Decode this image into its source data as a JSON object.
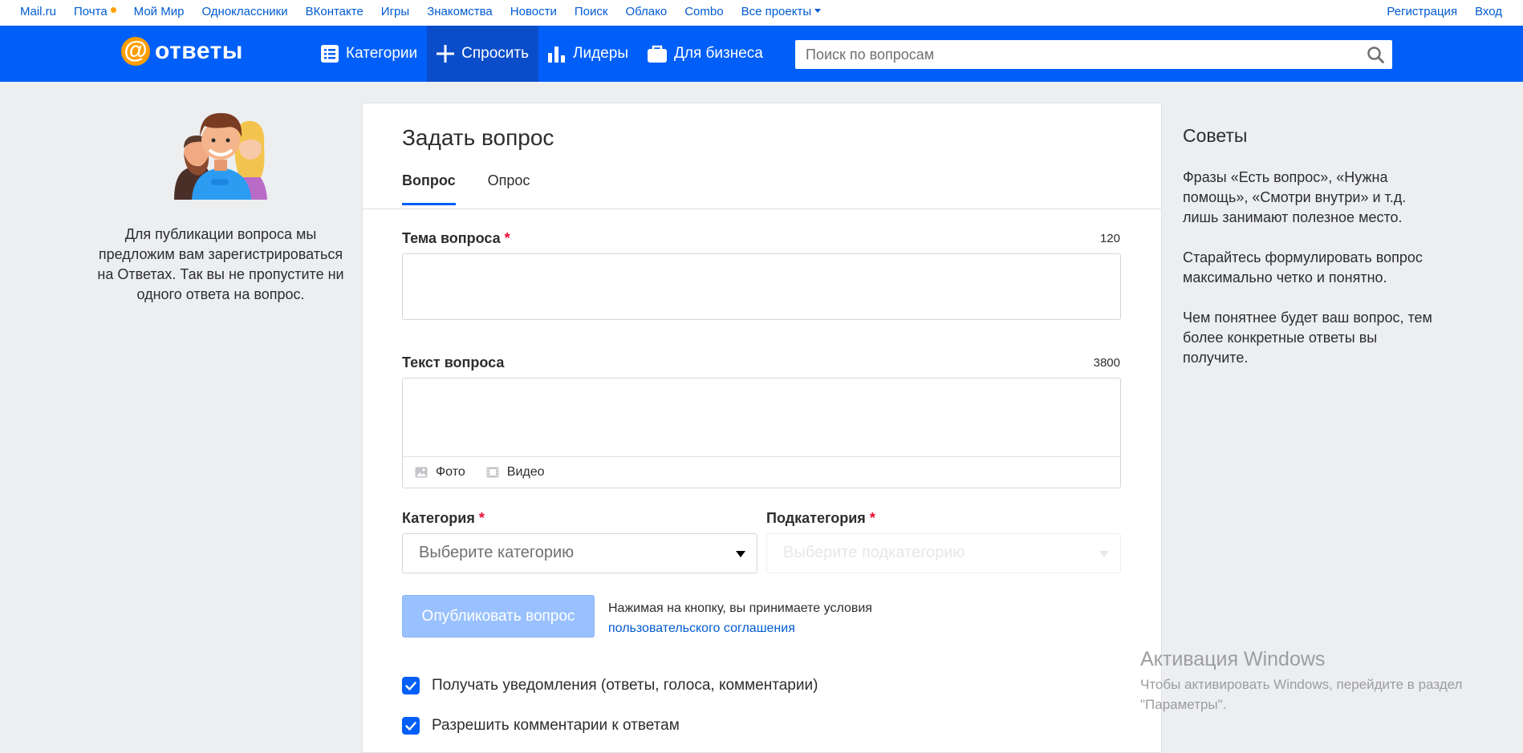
{
  "portal": {
    "links": [
      "Mail.ru",
      "Почта",
      "Мой Мир",
      "Одноклассники",
      "ВКонтакте",
      "Игры",
      "Знакомства",
      "Новости",
      "Поиск",
      "Облако",
      "Combo",
      "Все проекты"
    ],
    "register": "Регистрация",
    "login": "Вход"
  },
  "header": {
    "logo_at": "@",
    "logo_text": "ответы",
    "nav": [
      "Категории",
      "Спросить",
      "Лидеры",
      "Для бизнеса"
    ],
    "search_placeholder": "Поиск по вопросам"
  },
  "left": {
    "text": "Для публикации вопроса мы предложим вам зарегистрироваться на Ответах. Так вы не пропустите ни одного ответа на вопрос."
  },
  "form": {
    "title": "Задать вопрос",
    "tabs": [
      "Вопрос",
      "Опрос"
    ],
    "subject_label": "Тема вопроса",
    "subject_counter": "120",
    "text_label": "Текст вопроса",
    "text_counter": "3800",
    "attach_photo": "Фото",
    "attach_video": "Видео",
    "category_label": "Категория",
    "category_placeholder": "Выберите категорию",
    "subcategory_label": "Подкатегория",
    "subcategory_placeholder": "Выберите подкатегорию",
    "required_mark": "*",
    "publish": "Опубликовать вопрос",
    "terms_text": "Нажимая на кнопку, вы принимаете условия",
    "terms_link": "пользовательского соглашения",
    "check_notifications": "Получать уведомления (ответы, голоса, комментарии)",
    "check_comments": "Разрешить комментарии к ответам"
  },
  "tips": {
    "title": "Советы",
    "items": [
      "Фразы «Есть вопрос», «Нужна помощь», «Смотри внутри» и т.д. лишь занимают полезное место.",
      "Старайтесь формулировать вопрос максимально четко и понятно.",
      "Чем понятнее будет ваш вопрос, тем более конкретные ответы вы получите."
    ]
  },
  "watermark": {
    "title": "Активация Windows",
    "sub1": "Чтобы активировать Windows, перейдите в раздел",
    "sub2": "\"Параметры\"."
  },
  "colors": {
    "header_blue": "#005ff9",
    "active_nav": "#0b4dc9",
    "link_blue": "#005bd1",
    "required_red": "#ed0a34",
    "logo_orange": "#ff9e00",
    "button_disabled_blue": "#99c1ff"
  }
}
